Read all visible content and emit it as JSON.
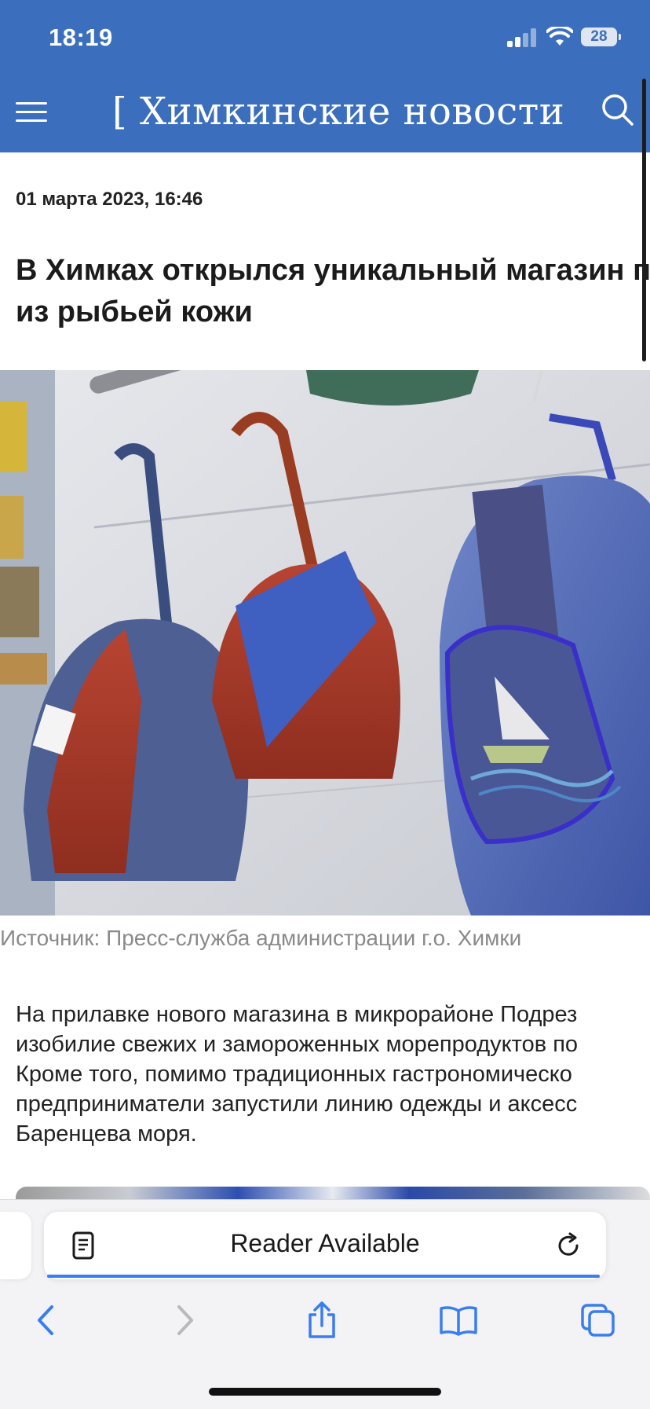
{
  "status_bar": {
    "time": "18:19",
    "battery": "28",
    "icons": [
      "signal-icon",
      "wifi-icon",
      "battery-icon"
    ]
  },
  "header": {
    "site_title": "[ Химкинские новости",
    "icons": [
      "menu-icon",
      "search-icon"
    ],
    "background_color": "#3b6fbd"
  },
  "article": {
    "date": "01 марта 2023, 16:46",
    "headline_lines": [
      "В Химках открылся уникальный магазин п",
      "из рыбьей кожи"
    ],
    "photo_caption": "Источник: Пресс-служба администрации г.о. Химки",
    "body_lines": [
      "На прилавке нового магазина в микрорайоне Подрез",
      "изобилие свежих и замороженных морепродуктов по",
      "Кроме того, помимо традиционных гастрономическо",
      "предприниматели запустили линию одежды и аксесс",
      "Баренцева моря."
    ]
  },
  "browser": {
    "address_bar_text": "Reader Available",
    "icons": [
      "reader-icon",
      "reload-icon"
    ],
    "accent_color": "#3a7df0",
    "nav": [
      "back-icon",
      "forward-icon",
      "share-icon",
      "bookmarks-icon",
      "tabs-icon"
    ]
  }
}
